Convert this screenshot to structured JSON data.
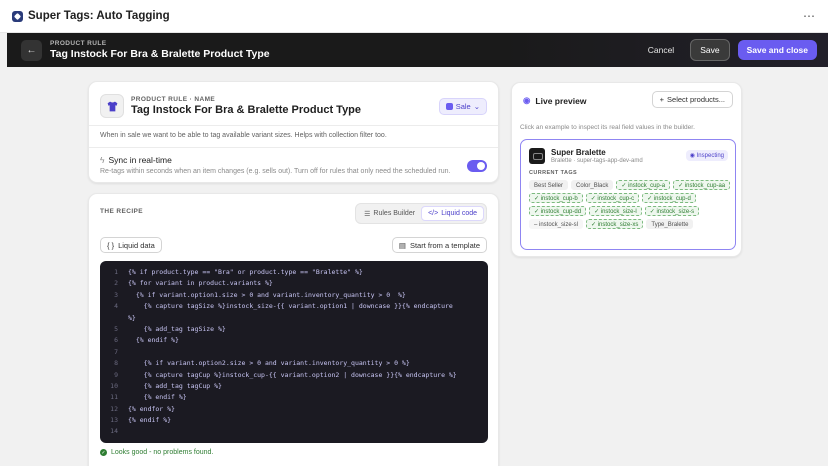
{
  "app": {
    "title": "Super Tags: Auto Tagging",
    "menu_glyph": "⋯"
  },
  "header": {
    "eyebrow": "PRODUCT RULE",
    "title": "Tag Instock For Bra & Bralette Product Type",
    "cancel_label": "Cancel",
    "save_label": "Save",
    "save_close_label": "Save and close"
  },
  "rule": {
    "eyebrow": "PRODUCT RULE · NAME",
    "name": "Tag Instock For Bra & Bralette Product Type",
    "trigger": "Sale",
    "description": "When in sale we want to be able to tag available variant sizes. Helps with collection filter too.",
    "sync_title": "Sync in real-time",
    "sync_description": "Re-tags within seconds when an item changes (e.g. sells out). Turn off for rules that only need the scheduled run.",
    "sync_enabled": true
  },
  "recipe": {
    "label": "THE RECIPE",
    "tabs": [
      {
        "label": "Rules Builder"
      },
      {
        "label": "Liquid code",
        "active": true
      }
    ],
    "liquid_data_label": "Liquid data",
    "template_label": "Start from a template",
    "code_lines": [
      {
        "n": "1",
        "text": "{% if product.type == \"Bra\" or product.type == \"Bralette\" %}"
      },
      {
        "n": "2",
        "text": "{% for variant in product.variants %}"
      },
      {
        "n": "3",
        "text": "  {% if variant.option1.size > 0 and variant.inventory_quantity > 0  %}"
      },
      {
        "n": "4",
        "text": "    {% capture tagSize %}instock_size-{{ variant.option1 | downcase }}{% endcapture"
      },
      {
        "n": "",
        "text": "%}"
      },
      {
        "n": "5",
        "text": "    {% add_tag tagSize %}"
      },
      {
        "n": "6",
        "text": "  {% endif %}"
      },
      {
        "n": "7",
        "text": ""
      },
      {
        "n": "8",
        "text": "    {% if variant.option2.size > 0 and variant.inventory_quantity > 0 %}"
      },
      {
        "n": "9",
        "text": "    {% capture tagCup %}instock_cup-{{ variant.option2 | downcase }}{% endcapture %}"
      },
      {
        "n": "10",
        "text": "    {% add_tag tagCup %}"
      },
      {
        "n": "11",
        "text": "    {% endif %}"
      },
      {
        "n": "12",
        "text": "{% endfor %}"
      },
      {
        "n": "13",
        "text": "{% endif %}"
      },
      {
        "n": "14",
        "text": ""
      }
    ],
    "status": "Looks good - no problems found."
  },
  "preview": {
    "title": "Live preview",
    "select_label": "Select products...",
    "hint": "Click an example to inspect its real field values in the builder.",
    "product": {
      "name": "Super Bralette",
      "subtitle": "Bralette · super-tags-app-dev-amd",
      "badge": "Inspecting",
      "tags_label": "CURRENT TAGS",
      "tags": [
        {
          "text": "Best Seller",
          "kind": "plain"
        },
        {
          "text": "Color_Black",
          "kind": "plain"
        },
        {
          "text": "✓ instock_cup-a",
          "kind": "add"
        },
        {
          "text": "✓ instock_cup-aa",
          "kind": "add"
        },
        {
          "text": "✓ instock_cup-b",
          "kind": "add"
        },
        {
          "text": "✓ instock_cup-c",
          "kind": "add"
        },
        {
          "text": "✓ instock_cup-d",
          "kind": "add"
        },
        {
          "text": "✓ instock_cup-dd",
          "kind": "add"
        },
        {
          "text": "✓ instock_size-l",
          "kind": "add"
        },
        {
          "text": "✓ instock_size-s",
          "kind": "add"
        },
        {
          "text": "– instock_size-sl",
          "kind": "rem"
        },
        {
          "text": "✓ instock_size-xs",
          "kind": "add"
        },
        {
          "text": "Type_Bralette",
          "kind": "plain"
        }
      ]
    }
  },
  "colors": {
    "accent": "#6a5cf0",
    "success": "#2e7d32",
    "code_bg": "#1b1a22"
  }
}
